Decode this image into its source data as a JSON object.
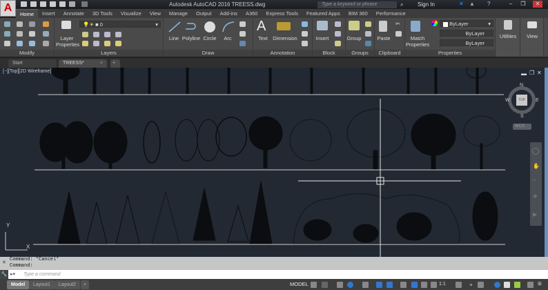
{
  "window": {
    "title": "Autodesk AutoCAD 2016    TREESS.dwg",
    "search_placeholder": "Type a keyword or phrase",
    "sign_in": "Sign In"
  },
  "app_button": "A",
  "ribbon_tabs": [
    "Home",
    "Insert",
    "Annotate",
    "3D Tools",
    "Visualize",
    "View",
    "Manage",
    "Output",
    "Add-ins",
    "A360",
    "Express Tools",
    "Featured Apps",
    "BIM 360",
    "Performance"
  ],
  "panels": {
    "modify": "Modify",
    "layers": "Layers",
    "draw": "Draw",
    "annotation": "Annotation",
    "block": "Block",
    "groups": "Groups",
    "clipboard": "Clipboard",
    "properties": "Properties"
  },
  "buttons": {
    "layer_properties": "Layer Properties",
    "line": "Line",
    "polyline": "Polyline",
    "circle": "Circle",
    "arc": "Arc",
    "text": "Text",
    "dimension": "Dimension",
    "insert": "Insert",
    "group": "Group",
    "paste": "Paste",
    "match_properties": "Match Properties",
    "utilities": "Utilities",
    "view": "View"
  },
  "layer_dropdown": "0",
  "properties": {
    "color": "ByLayer",
    "linetype": "ByLayer",
    "lineweight": "ByLayer"
  },
  "doc_tabs": [
    "Start",
    "TREESS*"
  ],
  "viewport_label": "[−][Top][2D Wireframe]",
  "viewcube": {
    "n": "N",
    "s": "S",
    "e": "E",
    "w": "W",
    "top": "TOP",
    "wcs": "WCS"
  },
  "ucs": {
    "x": "X",
    "y": "Y"
  },
  "command_history": [
    "Command: *Cancel*",
    "Command:"
  ],
  "command_placeholder": "Type a command",
  "layout_tabs": [
    "Model",
    "Layout1",
    "Layout2"
  ],
  "status": {
    "model": "MODEL",
    "scale": "1:1"
  }
}
